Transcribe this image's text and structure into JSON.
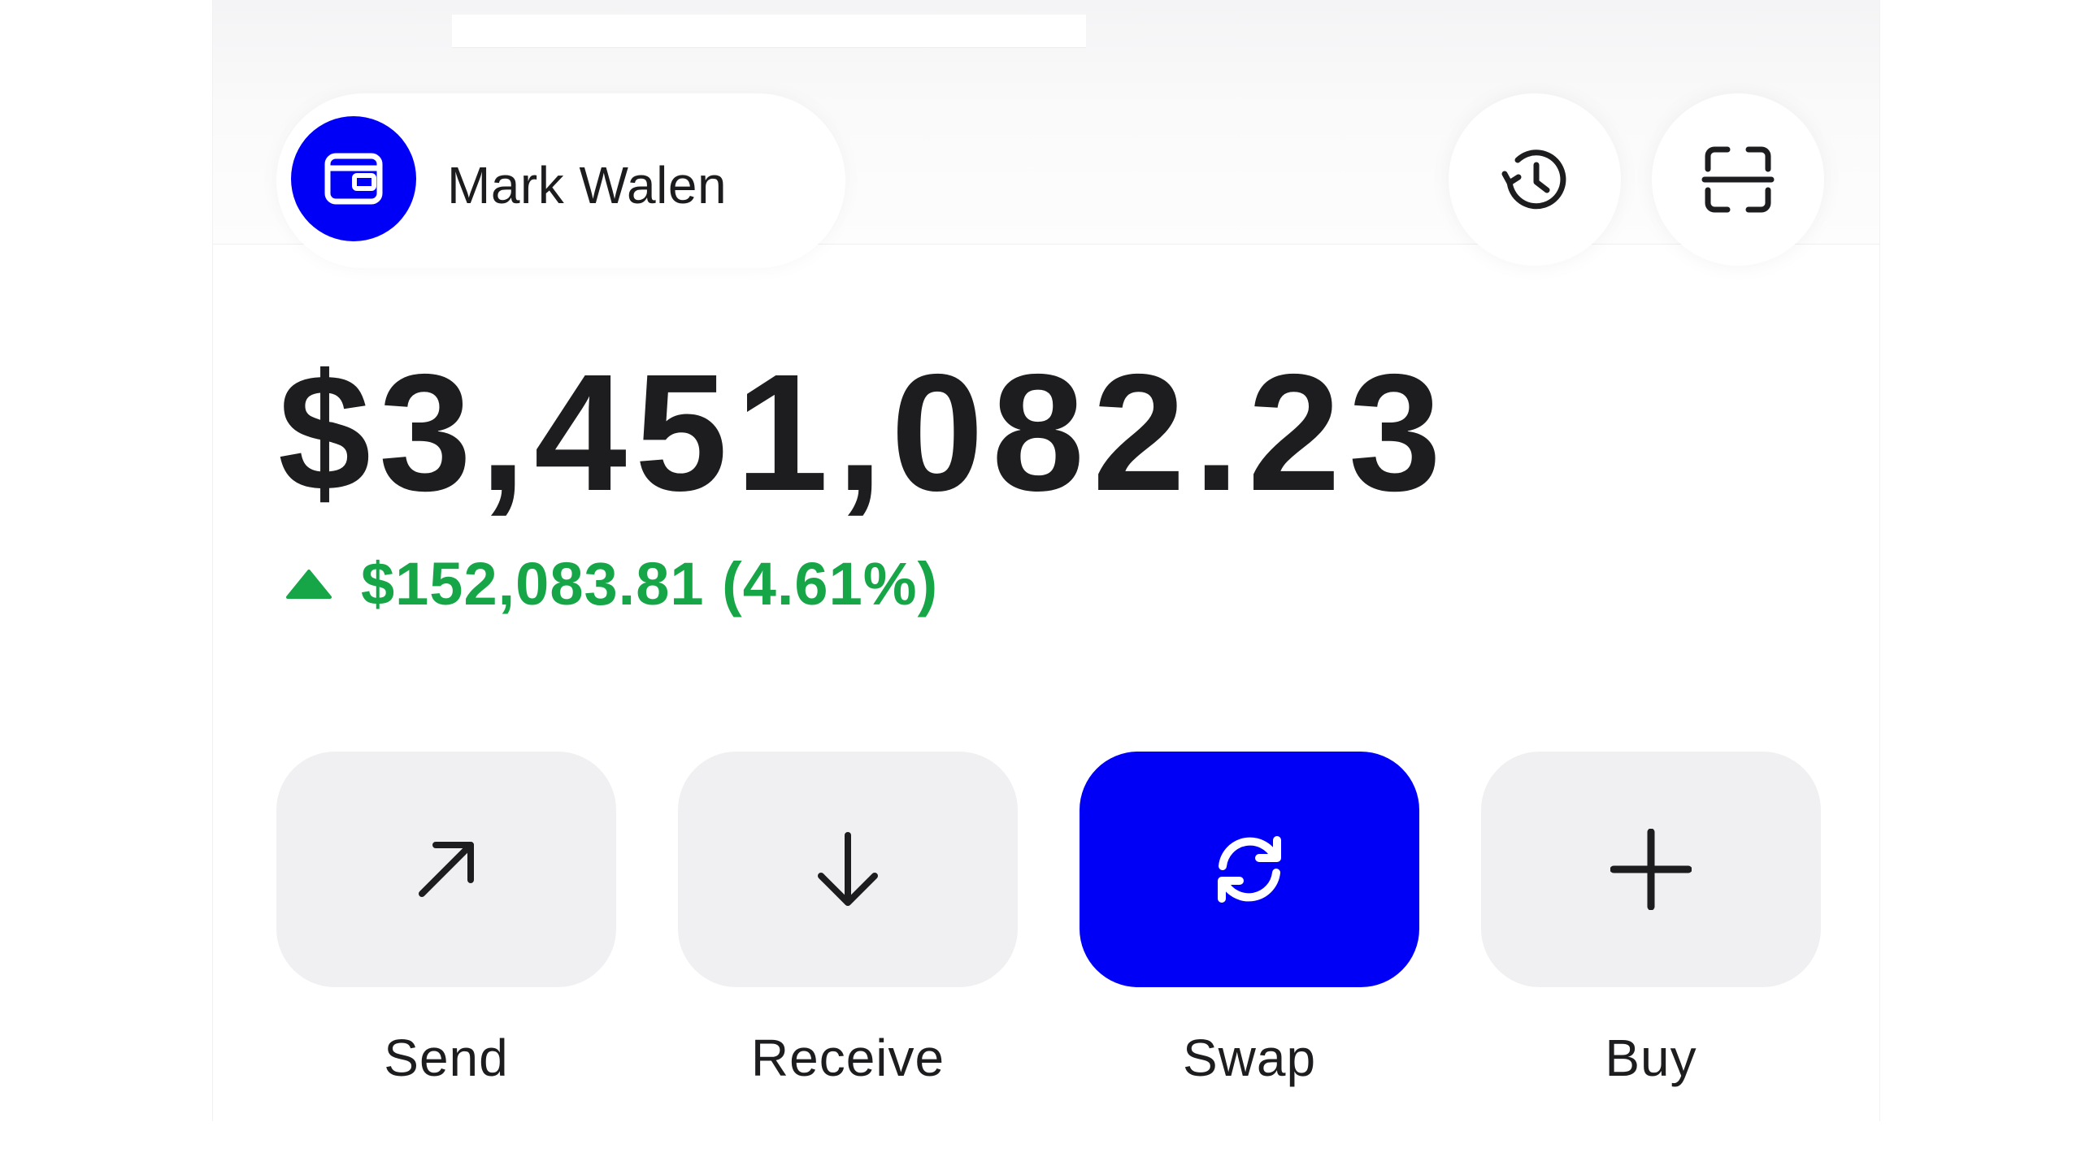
{
  "profile": {
    "name": "Mark Walen",
    "avatar_icon": "wallet-icon",
    "avatar_color": "#0000F7"
  },
  "header_actions": [
    {
      "icon": "history-icon"
    },
    {
      "icon": "scan-icon"
    }
  ],
  "balance": {
    "amount": "$3,451,082.23",
    "change": "$152,083.81 (4.61%)",
    "change_direction": "up",
    "change_color": "#16A648"
  },
  "actions": [
    {
      "label": "Send",
      "icon": "arrow-up-right-icon",
      "highlighted": false
    },
    {
      "label": "Receive",
      "icon": "arrow-down-icon",
      "highlighted": false
    },
    {
      "label": "Swap",
      "icon": "swap-icon",
      "highlighted": true
    },
    {
      "label": "Buy",
      "icon": "plus-icon",
      "highlighted": false
    }
  ],
  "colors": {
    "accent": "#0000F7",
    "button_background": "#F0F0F2",
    "text": "#1D1D1F",
    "positive": "#16A648"
  }
}
